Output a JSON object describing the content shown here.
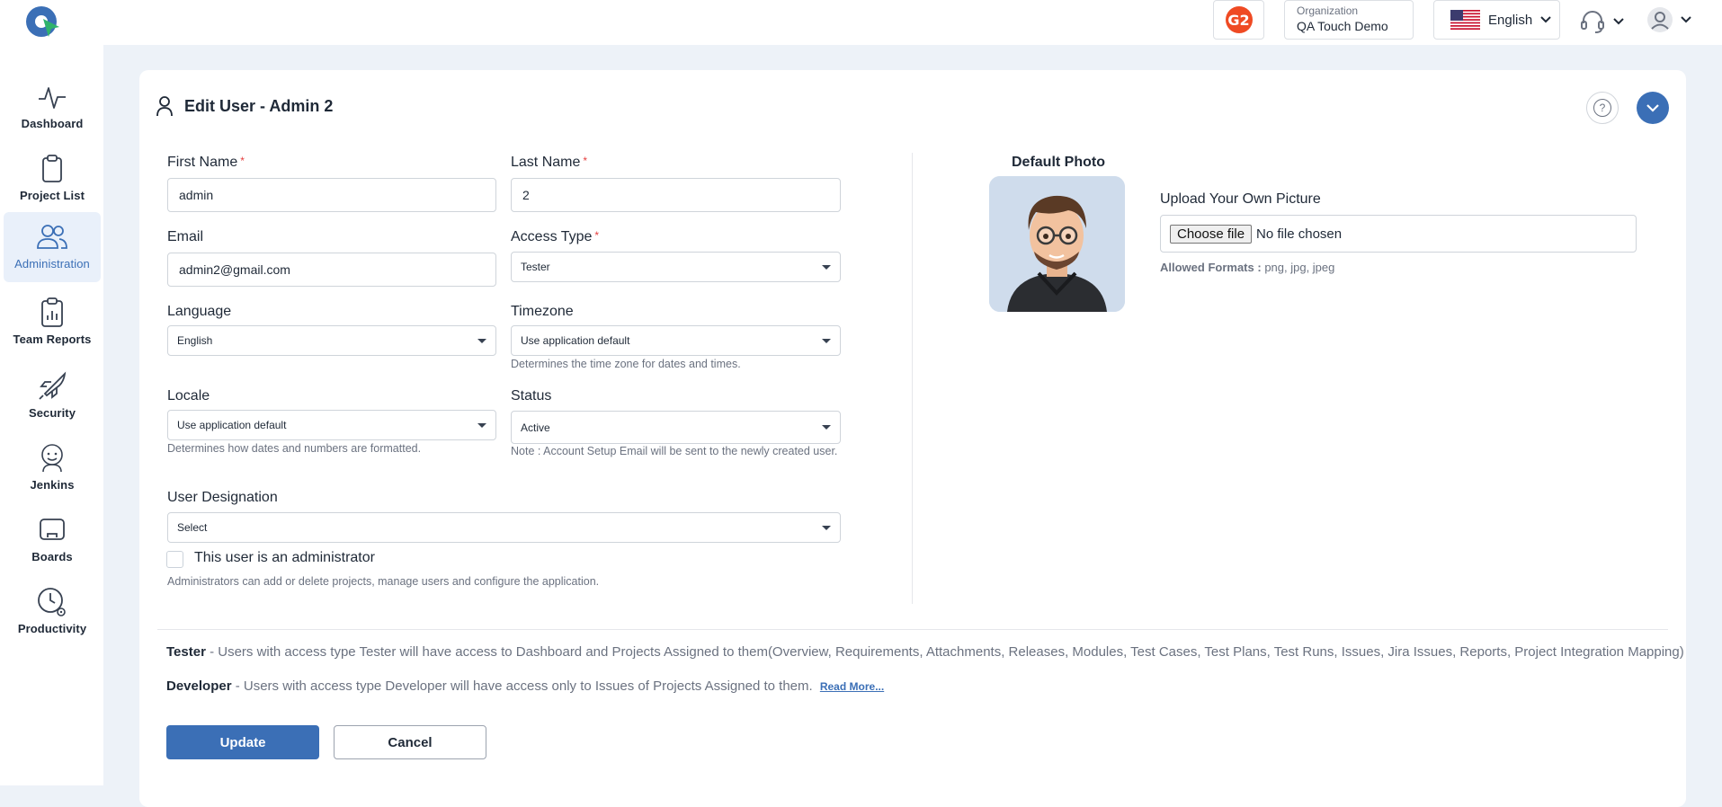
{
  "header": {
    "organization_label": "Organization",
    "organization_value": "QA Touch Demo",
    "language": "English",
    "g2_badge": "G2",
    "icons": [
      "app-logo-icon",
      "g2-logo-icon",
      "us-flag-icon",
      "headset-icon",
      "user-avatar-icon",
      "chevron-down-icon"
    ]
  },
  "sidebar": {
    "items": [
      {
        "label": "Dashboard",
        "icon": "pulse-icon"
      },
      {
        "label": "Project List",
        "icon": "clipboard-icon"
      },
      {
        "label": "Administration",
        "icon": "users-icon",
        "active": true
      },
      {
        "label": "Team Reports",
        "icon": "report-chart-icon"
      },
      {
        "label": "Security",
        "icon": "rocket-icon"
      },
      {
        "label": "Jenkins",
        "icon": "jenkins-icon"
      },
      {
        "label": "Boards",
        "icon": "board-icon"
      },
      {
        "label": "Productivity",
        "icon": "clock-gear-icon"
      }
    ]
  },
  "page": {
    "title": "Edit User - Admin 2"
  },
  "form": {
    "first_name": {
      "label": "First Name",
      "required": "*",
      "value": "admin"
    },
    "last_name": {
      "label": "Last Name",
      "required": "*",
      "value": "2"
    },
    "email": {
      "label": "Email",
      "value": "admin2@gmail.com"
    },
    "access_type": {
      "label": "Access Type",
      "required": "*",
      "value": "Tester"
    },
    "language": {
      "label": "Language",
      "value": "English"
    },
    "timezone": {
      "label": "Timezone",
      "value": "Use application default",
      "hint": "Determines the time zone for dates and times."
    },
    "locale": {
      "label": "Locale",
      "value": "Use application default",
      "hint": "Determines how dates and numbers are formatted."
    },
    "status": {
      "label": "Status",
      "value": "Active",
      "hint": "Note : Account Setup Email will be sent to the newly created user."
    },
    "designation": {
      "label": "User Designation",
      "value": "Select"
    },
    "admin_checkbox": {
      "label": "This user is an administrator",
      "checked": false,
      "hint": "Administrators can add or delete projects, manage users and configure the application."
    }
  },
  "photo": {
    "default_label": "Default Photo",
    "upload_label": "Upload Your Own Picture",
    "choose_button": "Choose file",
    "no_file": "No file chosen",
    "formats_label": "Allowed Formats :",
    "formats_value": "png, jpg, jpeg"
  },
  "descriptions": {
    "tester_role": "Tester",
    "tester_text": "- Users with access type Tester will have access to Dashboard and Projects Assigned to them(Overview, Requirements, Attachments, Releases, Modules, Test Cases, Test Plans, Test Runs, Issues, Jira Issues, Reports, Project Integration Mapping)",
    "developer_role": "Developer",
    "developer_text": "- Users with access type Developer will have access only to Issues of Projects Assigned to them.",
    "read_more": "Read More..."
  },
  "actions": {
    "update": "Update",
    "cancel": "Cancel"
  },
  "colors": {
    "accent": "#3b6fb6",
    "required": "#e53e3e",
    "background": "#edf2f8"
  }
}
